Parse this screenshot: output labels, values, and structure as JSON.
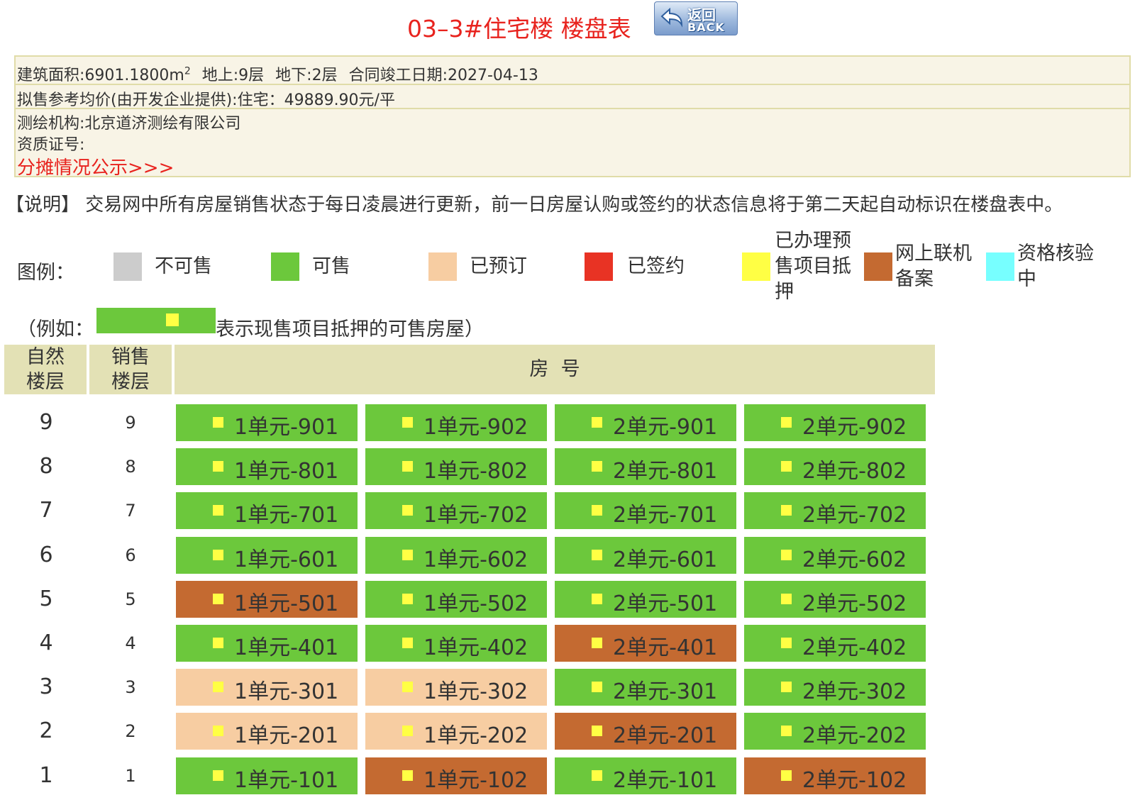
{
  "title": "03–3#住宅楼 楼盘表",
  "back_button": {
    "cn": "返回",
    "en": "BACK"
  },
  "info": {
    "area_label": "建筑面积:6901.1800m",
    "area_sup": "2",
    "above": "地上:9层",
    "below": "地下:2层",
    "completion": "合同竣工日期:2027-04-13",
    "price": "拟售参考均价(由开发企业提供):住宅：49889.90元/平",
    "org": "测绘机构:北京道济测绘有限公司",
    "cert": "资质证号:",
    "share_link": "分摊情况公示>>>"
  },
  "note": "【说明】 交易网中所有房屋销售状态于每日凌晨进行更新，前一日房屋认购或签约的状态信息将于第二天起自动标识在楼盘表中。",
  "legend": {
    "label": "图例：",
    "items": [
      {
        "text": "不可售",
        "color": "#cccccc"
      },
      {
        "text": "可售",
        "color": "#6cc83c"
      },
      {
        "text": "已预订",
        "color": "#f7cda2"
      },
      {
        "text": "已签约",
        "color": "#e83324"
      },
      {
        "text": "已办理预售项目抵押",
        "color": "#ffff44"
      },
      {
        "text": "网上联机备案",
        "color": "#c46a31"
      },
      {
        "text": "资格核验中",
        "color": "#77ffff"
      }
    ]
  },
  "example": {
    "prefix": "（例如：",
    "suffix": "表示现售项目抵押的可售房屋）"
  },
  "table": {
    "headers": {
      "natural_floor": "自然楼层",
      "sale_floor": "销售楼层",
      "room": "房  号"
    },
    "status_colors": {
      "available": "#6cc83c",
      "reserved": "#f7cda2",
      "filed": "#c46a31"
    },
    "rows": [
      {
        "natural": "9",
        "sale": "9",
        "units": [
          {
            "label": "1单元-901",
            "status": "available"
          },
          {
            "label": "1单元-902",
            "status": "available"
          },
          {
            "label": "2单元-901",
            "status": "available"
          },
          {
            "label": "2单元-902",
            "status": "available"
          }
        ]
      },
      {
        "natural": "8",
        "sale": "8",
        "units": [
          {
            "label": "1单元-801",
            "status": "available"
          },
          {
            "label": "1单元-802",
            "status": "available"
          },
          {
            "label": "2单元-801",
            "status": "available"
          },
          {
            "label": "2单元-802",
            "status": "available"
          }
        ]
      },
      {
        "natural": "7",
        "sale": "7",
        "units": [
          {
            "label": "1单元-701",
            "status": "available"
          },
          {
            "label": "1单元-702",
            "status": "available"
          },
          {
            "label": "2单元-701",
            "status": "available"
          },
          {
            "label": "2单元-702",
            "status": "available"
          }
        ]
      },
      {
        "natural": "6",
        "sale": "6",
        "units": [
          {
            "label": "1单元-601",
            "status": "available"
          },
          {
            "label": "1单元-602",
            "status": "available"
          },
          {
            "label": "2单元-601",
            "status": "available"
          },
          {
            "label": "2单元-602",
            "status": "available"
          }
        ]
      },
      {
        "natural": "5",
        "sale": "5",
        "units": [
          {
            "label": "1单元-501",
            "status": "filed"
          },
          {
            "label": "1单元-502",
            "status": "available"
          },
          {
            "label": "2单元-501",
            "status": "available"
          },
          {
            "label": "2单元-502",
            "status": "available"
          }
        ]
      },
      {
        "natural": "4",
        "sale": "4",
        "units": [
          {
            "label": "1单元-401",
            "status": "available"
          },
          {
            "label": "1单元-402",
            "status": "available"
          },
          {
            "label": "2单元-401",
            "status": "filed"
          },
          {
            "label": "2单元-402",
            "status": "available"
          }
        ]
      },
      {
        "natural": "3",
        "sale": "3",
        "units": [
          {
            "label": "1单元-301",
            "status": "reserved"
          },
          {
            "label": "1单元-302",
            "status": "reserved"
          },
          {
            "label": "2单元-301",
            "status": "available"
          },
          {
            "label": "2单元-302",
            "status": "available"
          }
        ]
      },
      {
        "natural": "2",
        "sale": "2",
        "units": [
          {
            "label": "1单元-201",
            "status": "reserved"
          },
          {
            "label": "1单元-202",
            "status": "reserved"
          },
          {
            "label": "2单元-201",
            "status": "filed"
          },
          {
            "label": "2单元-202",
            "status": "available"
          }
        ]
      },
      {
        "natural": "1",
        "sale": "1",
        "units": [
          {
            "label": "1单元-101",
            "status": "available"
          },
          {
            "label": "1单元-102",
            "status": "filed"
          },
          {
            "label": "2单元-101",
            "status": "available"
          },
          {
            "label": "2单元-102",
            "status": "filed"
          }
        ]
      }
    ]
  }
}
